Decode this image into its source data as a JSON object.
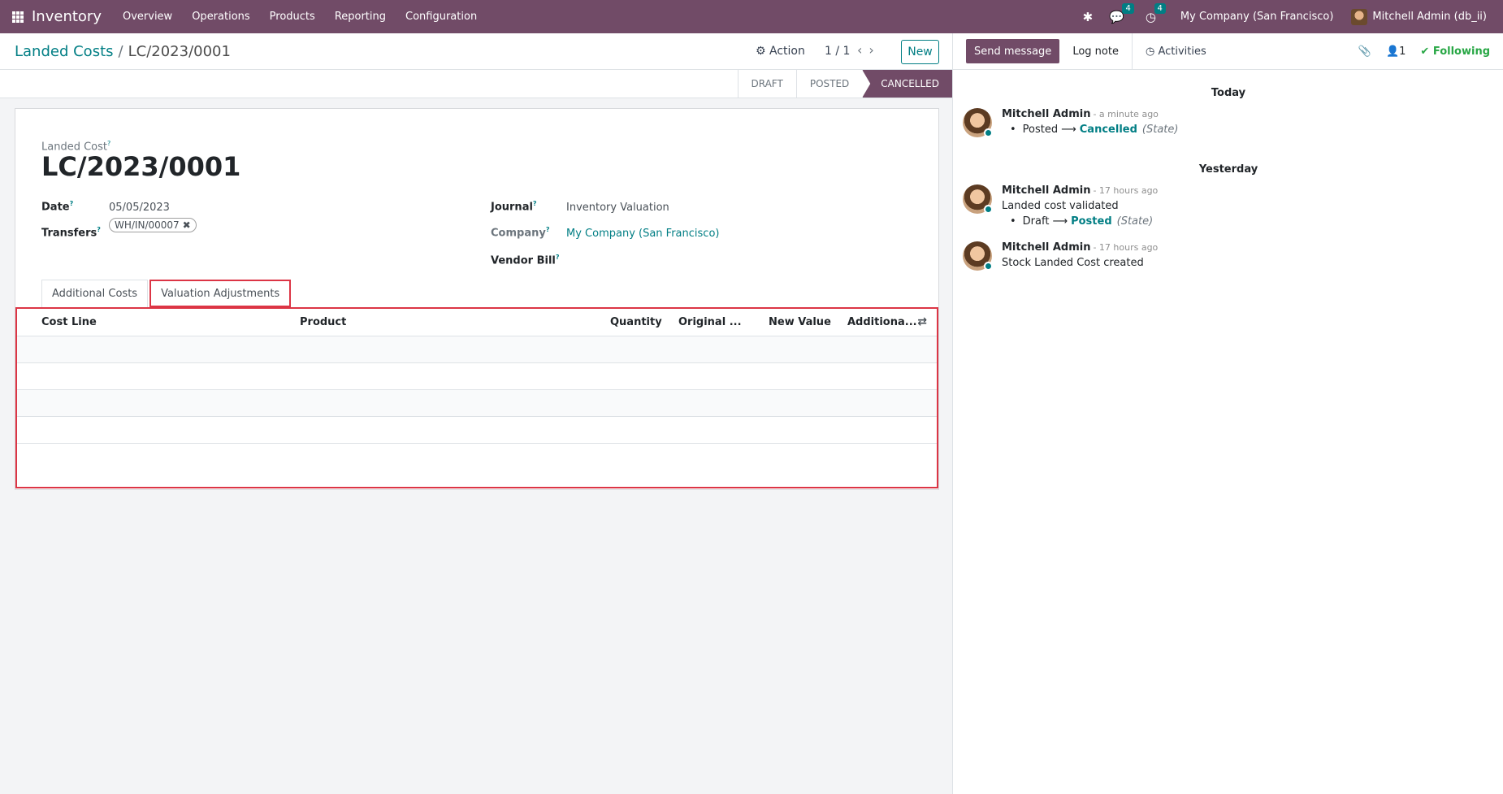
{
  "navbar": {
    "app_name": "Inventory",
    "menu": [
      "Overview",
      "Operations",
      "Products",
      "Reporting",
      "Configuration"
    ],
    "messages_count": "4",
    "activities_count": "4",
    "company": "My Company (San Francisco)",
    "user": "Mitchell Admin (db_ii)"
  },
  "control": {
    "breadcrumb_parent": "Landed Costs",
    "breadcrumb_sep": "/",
    "breadcrumb_current": "LC/2023/0001",
    "action_label": "Action",
    "pager": "1 / 1",
    "new_label": "New"
  },
  "status": {
    "stages": [
      "DRAFT",
      "POSTED",
      "CANCELLED"
    ],
    "active": "CANCELLED"
  },
  "form": {
    "name_label": "Landed Cost",
    "name": "LC/2023/0001",
    "date_label": "Date",
    "date": "05/05/2023",
    "transfers_label": "Transfers",
    "transfer_tag": "WH/IN/00007",
    "journal_label": "Journal",
    "journal": "Inventory Valuation",
    "company_label": "Company",
    "company": "My Company (San Francisco)",
    "vendor_bill_label": "Vendor Bill",
    "help_mark": "?"
  },
  "tabs": [
    "Additional Costs",
    "Valuation Adjustments"
  ],
  "table": {
    "columns": [
      "Cost Line",
      "Product",
      "Quantity",
      "Original ...",
      "New Value",
      "Additiona..."
    ]
  },
  "chatter": {
    "send_message": "Send message",
    "log_note": "Log note",
    "activities": "Activities",
    "followers_count": "1",
    "following": "Following",
    "days": [
      "Today",
      "Yesterday"
    ],
    "messages": [
      {
        "author": "Mitchell Admin",
        "when": "- a minute ago",
        "old": "Posted",
        "new": "Cancelled",
        "field": "(State)"
      },
      {
        "author": "Mitchell Admin",
        "when": "- 17 hours ago",
        "text": "Landed cost validated",
        "old": "Draft",
        "new": "Posted",
        "field": "(State)"
      },
      {
        "author": "Mitchell Admin",
        "when": "- 17 hours ago",
        "text": "Stock Landed Cost created"
      }
    ]
  },
  "colors": {
    "brand": "#714b67",
    "accent": "#017e84",
    "highlight": "#dc3545",
    "following": "#28a745"
  }
}
